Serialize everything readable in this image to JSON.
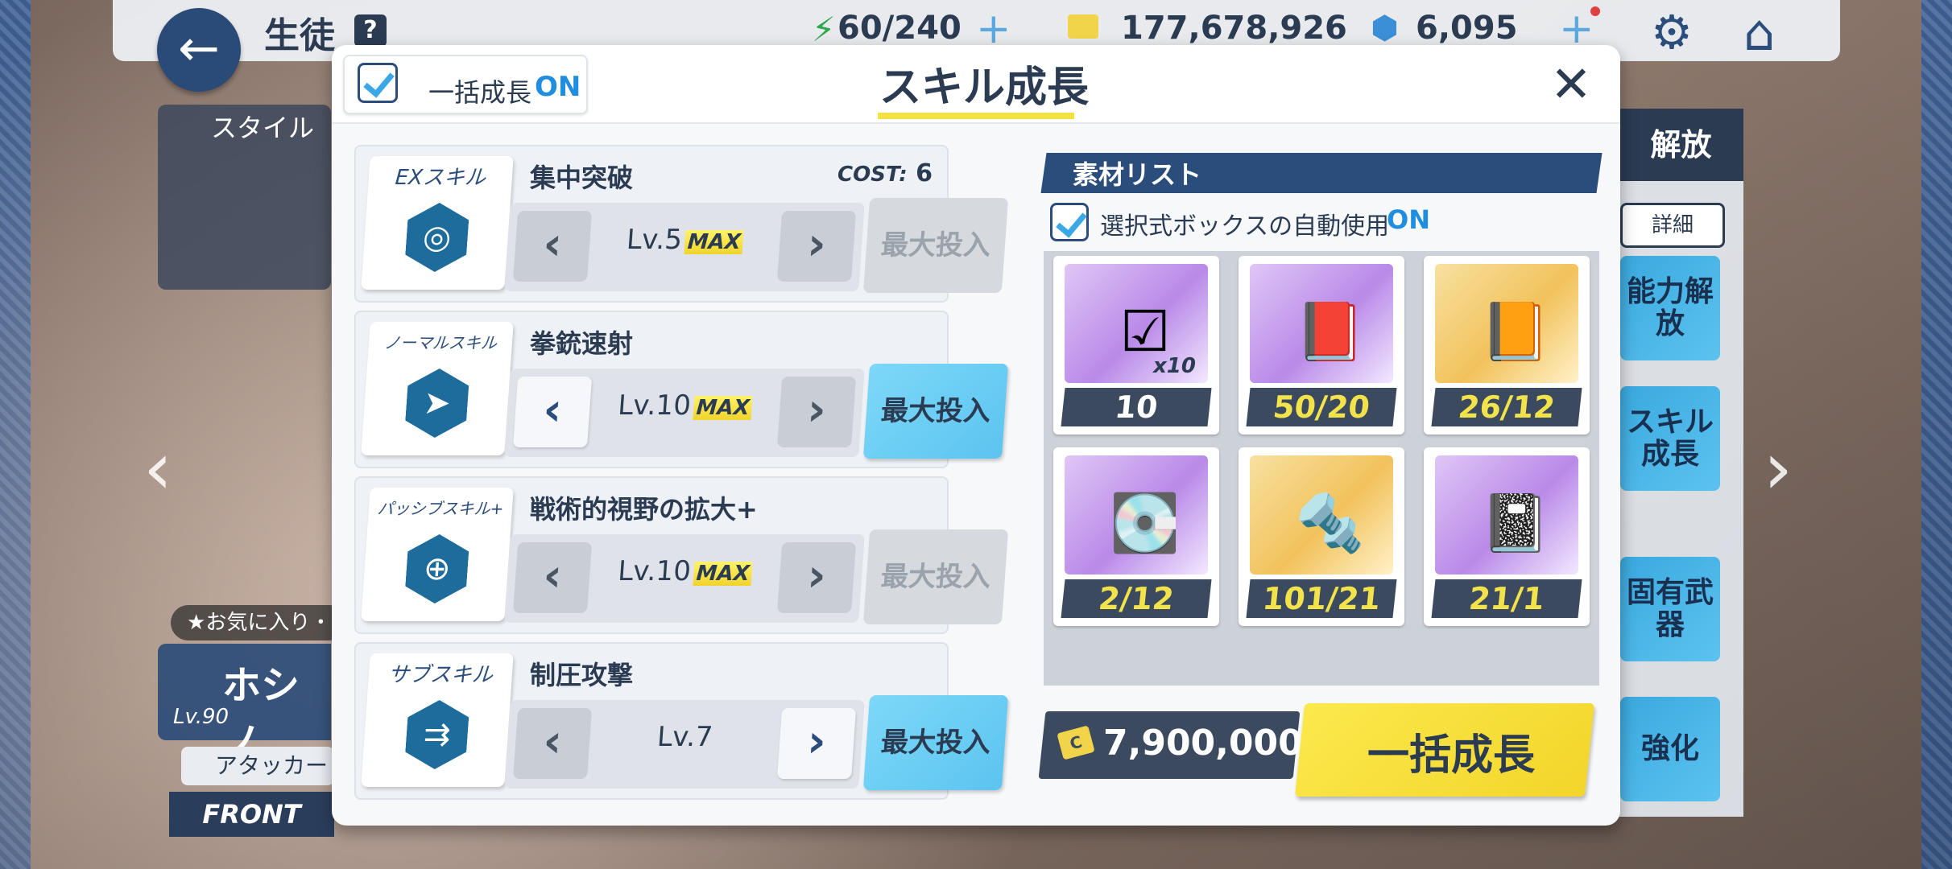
{
  "topbar": {
    "title": "生徒",
    "help": "?",
    "ap": "60/240",
    "credits": "177,678,926",
    "pyroxene": "6,095"
  },
  "background": {
    "style_label": "スタイル",
    "favorite_label": "お気に入り・",
    "char_name": "ホシノ",
    "char_level": "Lv.90",
    "role": "アタッカー",
    "position": "FRONT",
    "right_header": "解放",
    "detail": "詳細",
    "right_buttons": [
      "能力解放",
      "スキル成長",
      "固有武器",
      "強化"
    ]
  },
  "dialog": {
    "title": "スキル成長",
    "bulk_label": "一括成長",
    "bulk_state": "ON",
    "skills": [
      {
        "type": "EXスキル",
        "name": "集中突破",
        "cost_label": "COST:",
        "cost": "6",
        "level": "Lv.5",
        "max": "MAX",
        "invest": "最大投入",
        "invest_enabled": false,
        "icon": "ex-skill-icon"
      },
      {
        "type": "ノーマルスキル",
        "name": "拳銃速射",
        "level": "Lv.10",
        "max": "MAX",
        "invest": "最大投入",
        "invest_enabled": true,
        "icon": "normal-skill-icon"
      },
      {
        "type": "パッシブスキル+",
        "name": "戦術的視野の拡大+",
        "level": "Lv.10",
        "max": "MAX",
        "invest": "最大投入",
        "invest_enabled": false,
        "icon": "passive-skill-icon"
      },
      {
        "type": "サブスキル",
        "name": "制圧攻撃",
        "level": "Lv.7",
        "max": "",
        "invest": "最大投入",
        "invest_enabled": true,
        "icon": "sub-skill-icon"
      }
    ],
    "materials": {
      "title": "素材リスト",
      "auto_label": "選択式ボックスの自動使用",
      "auto_state": "ON",
      "items": [
        {
          "count": "10",
          "mult": "x10",
          "color": "white",
          "icon": "selector-box-icon"
        },
        {
          "count": "50/20",
          "color": "yellow",
          "icon": "abydos-book-purple-icon"
        },
        {
          "count": "26/12",
          "color": "yellow",
          "icon": "abydos-book-gold-icon"
        },
        {
          "count": "2/12",
          "color": "yellow",
          "icon": "hard-disk-icon"
        },
        {
          "count": "101/21",
          "color": "yellow",
          "icon": "artifact-icon"
        },
        {
          "count": "21/1",
          "color": "yellow",
          "icon": "technique-notebook-icon"
        }
      ]
    },
    "credit_cost": "7,900,000",
    "bulk_button": "一括成長"
  }
}
